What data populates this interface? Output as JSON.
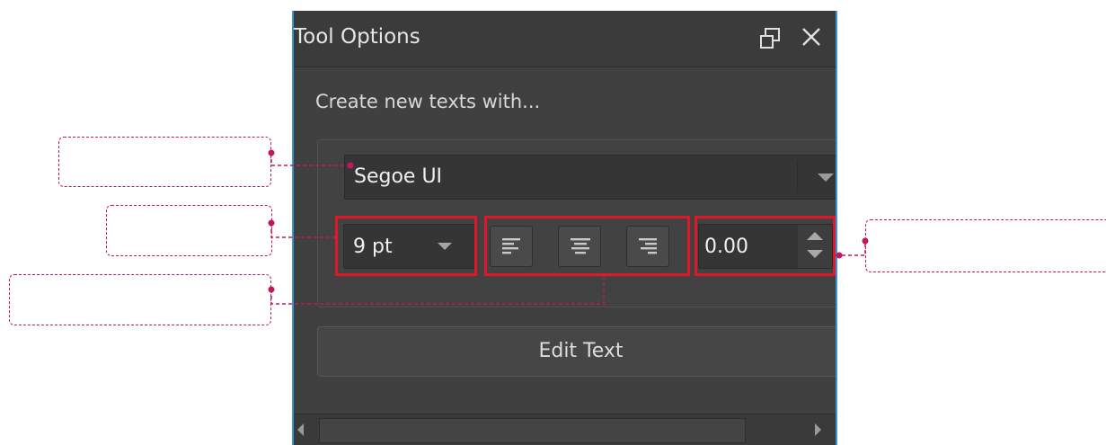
{
  "window": {
    "title": "Tool Options"
  },
  "section": {
    "label": "Create new texts with..."
  },
  "font": {
    "name": "Segoe UI"
  },
  "size": {
    "value": "9 pt"
  },
  "spacing": {
    "value": "0.00"
  },
  "buttons": {
    "edit_text": "Edit Text"
  },
  "icons": {
    "float": "float-window-icon",
    "close": "close-icon",
    "align_left": "align-left-icon",
    "align_center": "align-center-icon",
    "align_right": "align-right-icon"
  },
  "colors": {
    "panel_bg": "#3d3d3d",
    "panel_border": "#2f9ad6",
    "highlight": "#e0162b",
    "callout": "#c2185b"
  }
}
